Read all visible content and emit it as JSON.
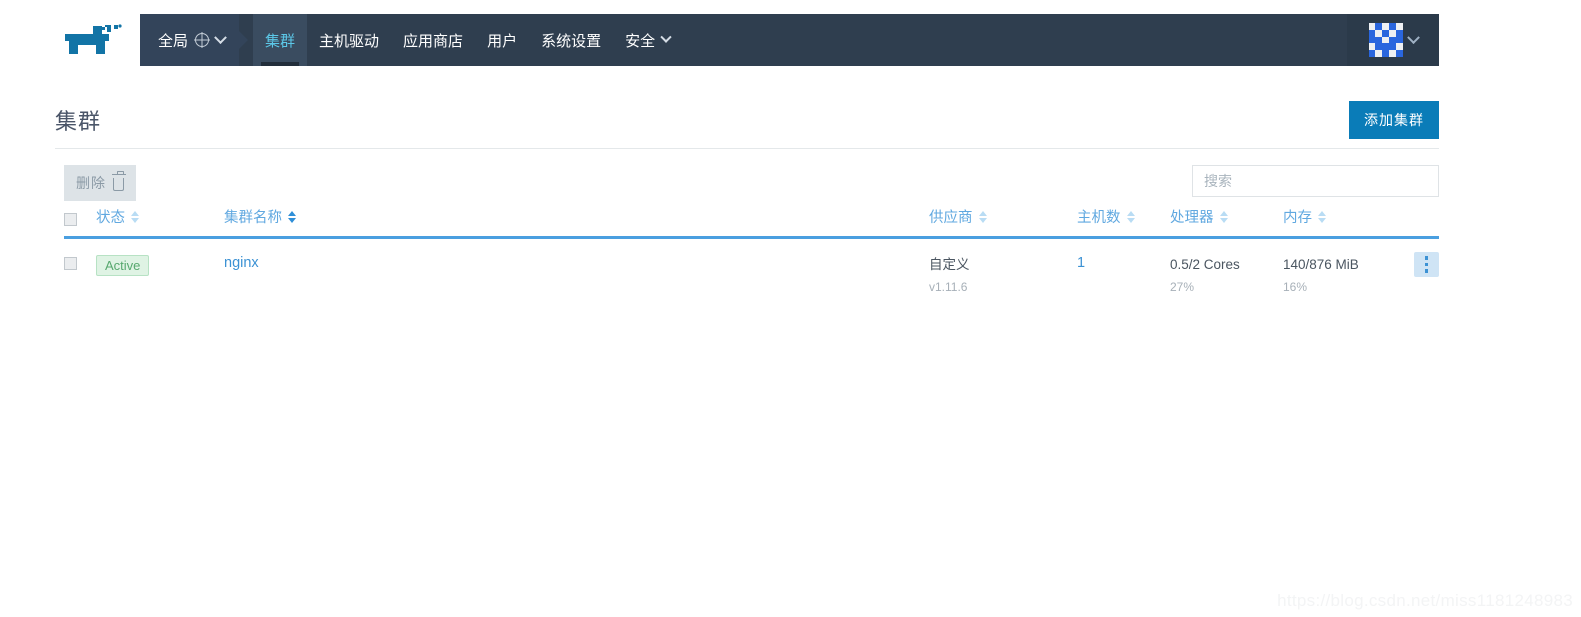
{
  "nav": {
    "logo_alt": "rancher-logo",
    "global": {
      "label": "全局",
      "globe_icon": "globe-icon",
      "chevron": "chevron-down-icon"
    },
    "items": [
      {
        "label": "集群",
        "active": true,
        "has_chevron": false
      },
      {
        "label": "主机驱动",
        "active": false,
        "has_chevron": false
      },
      {
        "label": "应用商店",
        "active": false,
        "has_chevron": false
      },
      {
        "label": "用户",
        "active": false,
        "has_chevron": false
      },
      {
        "label": "系统设置",
        "active": false,
        "has_chevron": false
      },
      {
        "label": "安全",
        "active": false,
        "has_chevron": true
      }
    ],
    "user_menu": {
      "avatar": "identicon-avatar",
      "chevron": "chevron-down-icon"
    }
  },
  "header": {
    "title": "集群",
    "add_button": "添加集群"
  },
  "toolbar": {
    "delete_label": "删除",
    "delete_icon": "trash-icon",
    "search_placeholder": "搜索",
    "search_value": ""
  },
  "table": {
    "columns": [
      {
        "key": "state",
        "label": "状态",
        "sortable": true,
        "sort_active": false
      },
      {
        "key": "name",
        "label": "集群名称",
        "sortable": true,
        "sort_active": true
      },
      {
        "key": "provider",
        "label": "供应商",
        "sortable": true,
        "sort_active": false
      },
      {
        "key": "hosts",
        "label": "主机数",
        "sortable": true,
        "sort_active": false
      },
      {
        "key": "cpu",
        "label": "处理器",
        "sortable": true,
        "sort_active": false
      },
      {
        "key": "memory",
        "label": "内存",
        "sortable": true,
        "sort_active": false
      }
    ],
    "rows": [
      {
        "state": "Active",
        "name": "nginx",
        "provider": "自定义",
        "provider_version": "v1.11.6",
        "hosts": "1",
        "cpu": "0.5/2 Cores",
        "cpu_percent": "27%",
        "memory": "140/876 MiB",
        "memory_percent": "16%",
        "actions_icon": "kebab-menu-icon"
      }
    ]
  },
  "watermark": "https://blog.csdn.net/miss1181248983",
  "colors": {
    "nav_bg": "#2f3e4f",
    "nav_global_bg": "#33445a",
    "active_tab_text": "#5cc8e8",
    "primary_button": "#0a7cb8",
    "link": "#3c92d4",
    "table_header_text": "#60a8e0",
    "table_underline": "#4a9fe0",
    "badge_text": "#57a86e",
    "badge_bg": "#dff3e4"
  }
}
